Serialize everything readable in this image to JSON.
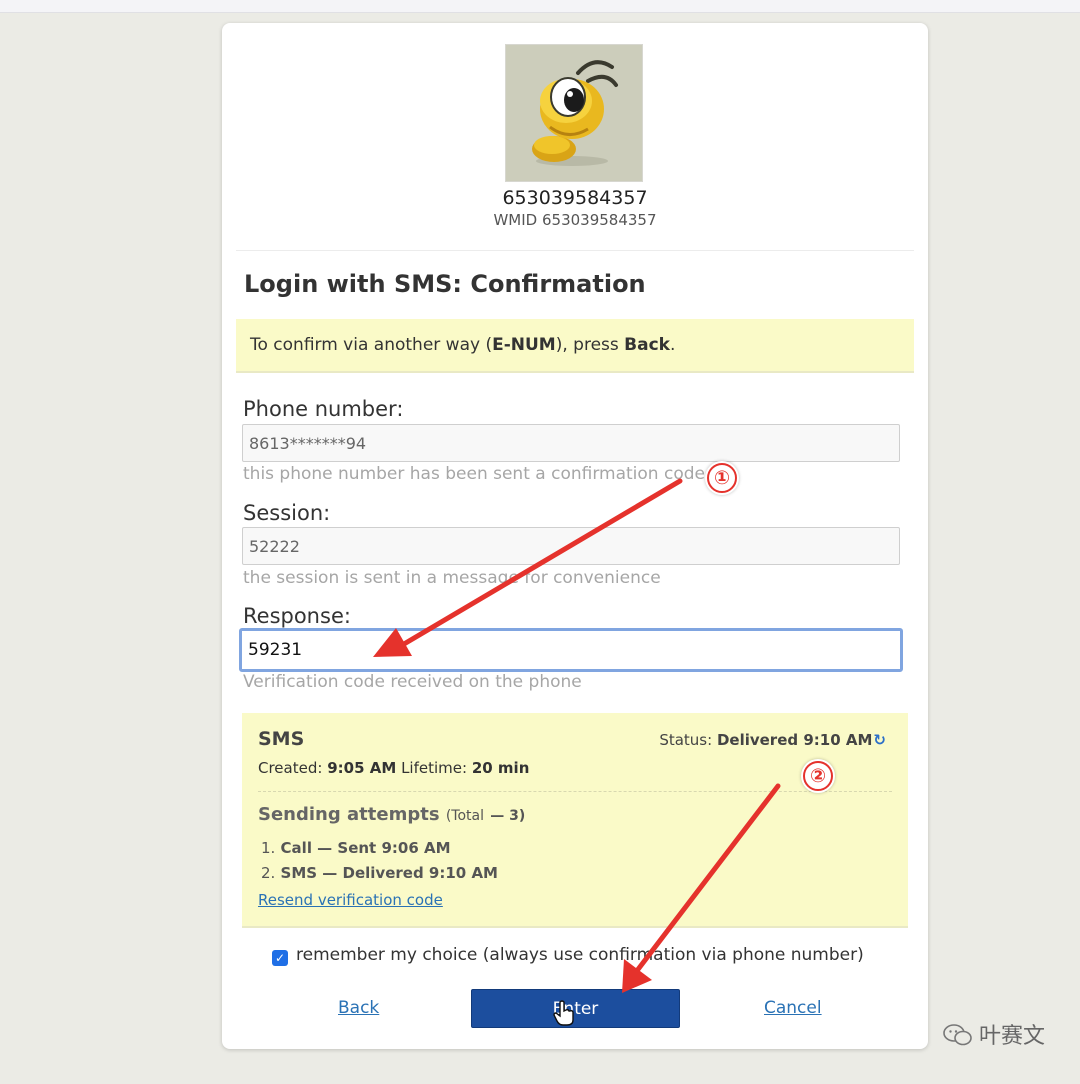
{
  "profile": {
    "wm_name": "653039584357",
    "wmid_line": "WMID 653039584357",
    "avatar_icon": "ant-mascot-icon"
  },
  "page": {
    "title": "Login with SMS: Confirmation",
    "hint": {
      "prefix": "To confirm via another way (",
      "method": "E-NUM",
      "middle": "), press ",
      "action": "Back",
      "suffix": "."
    }
  },
  "fields": {
    "phone": {
      "label": "Phone number:",
      "value": "8613*******94",
      "help": "this phone number has been sent a confirmation code"
    },
    "session": {
      "label": "Session:",
      "value": "52222",
      "help": "the session is sent in a message for convenience"
    },
    "response": {
      "label": "Response:",
      "value": "59231",
      "help": "Verification code received on the phone"
    }
  },
  "sms": {
    "title": "SMS",
    "status_label": "Status:",
    "status_value": "Delivered 9:10 AM",
    "refresh_icon": "refresh-icon",
    "created_label": "Created:",
    "created_value": "9:05 AM",
    "lifetime_label": "Lifetime:",
    "lifetime_value": "20 min",
    "attempts_title": "Sending attempts",
    "attempts_total_label": "(Total",
    "attempts_total_value": "— 3)",
    "attempts": [
      {
        "num": "1.",
        "text": "Call — Sent 9:06 AM"
      },
      {
        "num": "2.",
        "text": "SMS — Delivered 9:10 AM"
      }
    ],
    "resend_label": "Resend verification code"
  },
  "remember": {
    "checked": true,
    "label": "remember my choice (always use confirmation via phone number)"
  },
  "actions": {
    "back_label": "Back",
    "enter_label": "Enter",
    "cancel_label": "Cancel"
  },
  "annotations": {
    "marker_1": "①",
    "marker_2": "②",
    "arrow_color": "#e5322c"
  },
  "watermark": {
    "text": "叶赛文",
    "icon": "wechat-icon"
  },
  "colors": {
    "primary_button": "#1c4e9e",
    "link": "#2a72b5",
    "highlight_bg": "#fafac8",
    "focus_border": "#80a5e0"
  }
}
